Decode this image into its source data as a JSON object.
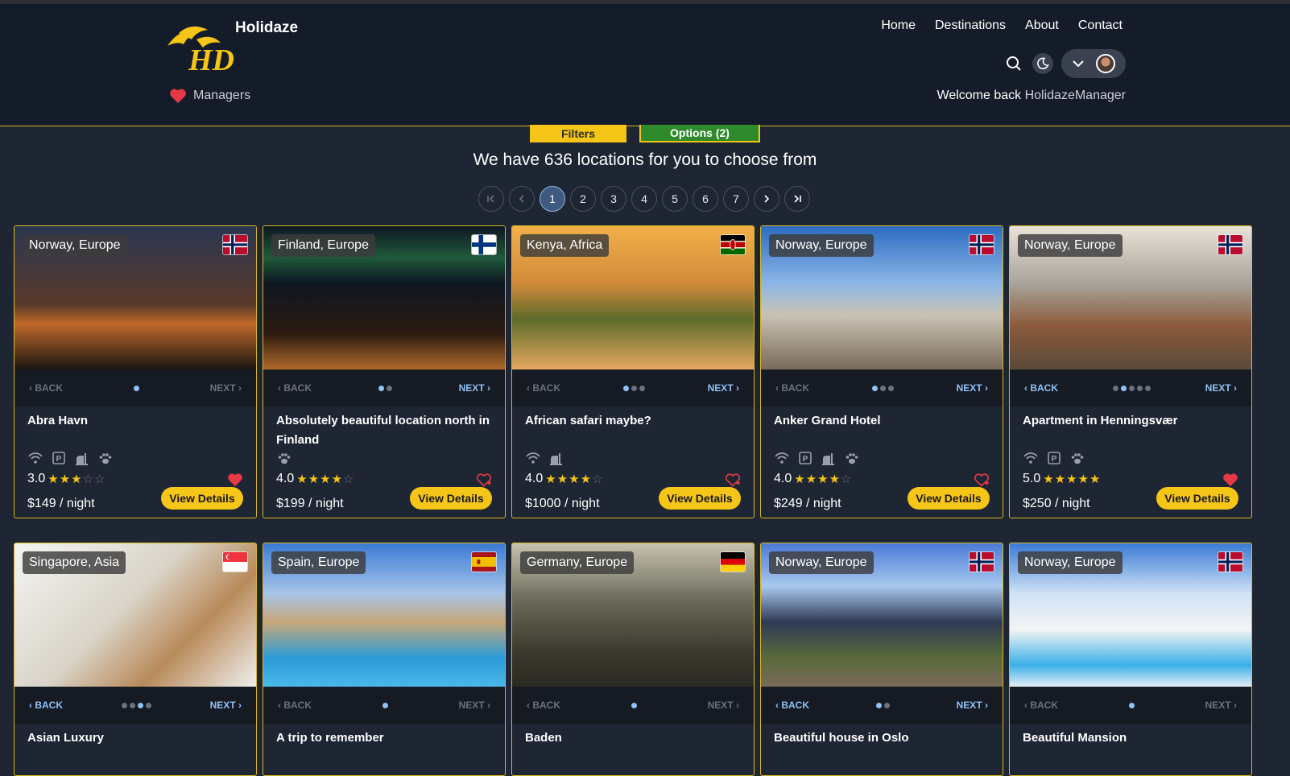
{
  "header": {
    "brand": "Holidaze",
    "managers_label": "Managers",
    "nav": [
      "Home",
      "Destinations",
      "About",
      "Contact"
    ],
    "welcome_prefix": "Welcome back",
    "username": "HolidazeManager"
  },
  "tabs": {
    "filters": "Filters",
    "options": "Options (2)"
  },
  "summary": "We have 636 locations for you to choose from",
  "pagination": {
    "pages": [
      "1",
      "2",
      "3",
      "4",
      "5",
      "6",
      "7"
    ],
    "current": "1",
    "first": "|‹",
    "prev": "‹",
    "next": "›",
    "last": "›|"
  },
  "carousel": {
    "back": "BACK",
    "next": "NEXT"
  },
  "details_label": "View Details",
  "cards": [
    {
      "location": "Norway, Europe",
      "flag": "norway",
      "title": "Abra Havn",
      "rating": "3.0",
      "stars": 3,
      "price": "$149 / night",
      "favorite": true,
      "amenities": [
        "wifi-icon",
        "parking-icon",
        "breakfast-icon",
        "pets-icon"
      ],
      "image_count": 1,
      "image_index": 0
    },
    {
      "location": "Finland, Europe",
      "flag": "finland",
      "title": "Absolutely beautiful location north in Finland",
      "rating": "4.0",
      "stars": 4,
      "price": "$199 / night",
      "favorite": false,
      "amenities": [
        "pets-icon"
      ],
      "image_count": 2,
      "image_index": 0
    },
    {
      "location": "Kenya, Africa",
      "flag": "kenya",
      "title": "African safari maybe?",
      "rating": "4.0",
      "stars": 4,
      "price": "$1000 / night",
      "favorite": false,
      "amenities": [
        "wifi-icon",
        "breakfast-icon"
      ],
      "image_count": 3,
      "image_index": 0
    },
    {
      "location": "Norway, Europe",
      "flag": "norway",
      "title": "Anker Grand Hotel",
      "rating": "4.0",
      "stars": 4,
      "price": "$249 / night",
      "favorite": false,
      "amenities": [
        "wifi-icon",
        "parking-icon",
        "breakfast-icon",
        "pets-icon"
      ],
      "image_count": 3,
      "image_index": 0
    },
    {
      "location": "Norway, Europe",
      "flag": "norway",
      "title": "Apartment in Henningsvær",
      "rating": "5.0",
      "stars": 5,
      "price": "$250 / night",
      "favorite": true,
      "amenities": [
        "wifi-icon",
        "parking-icon",
        "pets-icon"
      ],
      "image_count": 5,
      "image_index": 1
    },
    {
      "location": "Singapore, Asia",
      "flag": "singapore",
      "title": "Asian Luxury",
      "image_count": 4,
      "image_index": 2
    },
    {
      "location": "Spain, Europe",
      "flag": "spain",
      "title": "A trip to remember",
      "image_count": 1,
      "image_index": 0
    },
    {
      "location": "Germany, Europe",
      "flag": "germany",
      "title": "Baden",
      "image_count": 1,
      "image_index": 0
    },
    {
      "location": "Norway, Europe",
      "flag": "norway",
      "title": "Beautiful house in Oslo",
      "image_count": 2,
      "image_index": 0
    },
    {
      "location": "Norway, Europe",
      "flag": "norway",
      "title": "Beautiful Mansion",
      "image_count": 1,
      "image_index": 0
    }
  ],
  "colors": {
    "accent": "#f5c518",
    "background": "#1e2533",
    "header": "#151c29",
    "link": "#90c2f7",
    "options": "#2f8a2b"
  }
}
